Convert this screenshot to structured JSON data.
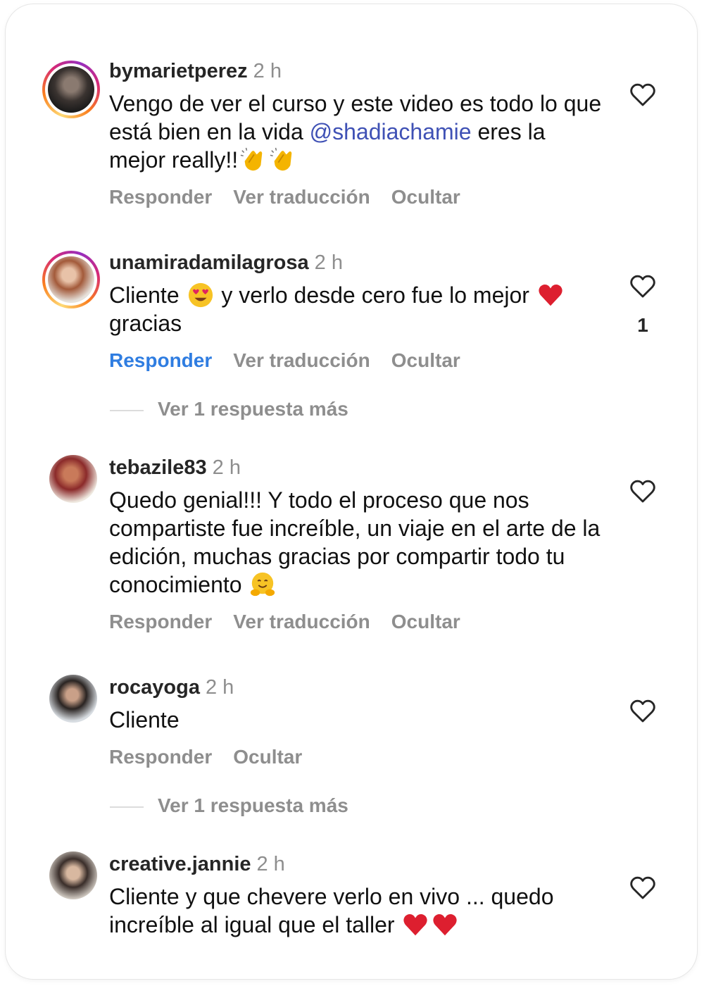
{
  "actions": {
    "reply": "Responder",
    "translate": "Ver traducción",
    "hide": "Ocultar"
  },
  "comments": [
    {
      "username": "bymarietperez",
      "time": "2 h",
      "text_before": "Vengo de ver el curso y este video es todo lo que está bien en la vida ",
      "mention": "@shadiachamie",
      "text_after": " eres la mejor really!!",
      "emojis": [
        "clapping-hands",
        "clapping-hands"
      ]
    },
    {
      "username": "unamiradamilagrosa",
      "time": "2 h",
      "text_a": "Cliente ",
      "text_b": " y verlo desde cero fue lo mejor ",
      "text_c": " gracias",
      "emojis": [
        "heart-eyes-face",
        "red-heart"
      ],
      "like_count": "1",
      "more_replies": "Ver 1 respuesta más"
    },
    {
      "username": "tebazile83",
      "time": "2 h",
      "text": "Quedo genial!!! Y todo el proceso que nos compartiste fue increíble, un viaje en el arte de la edición, muchas gracias por compartir todo tu conocimiento ",
      "emojis": [
        "hugging-face"
      ]
    },
    {
      "username": "rocayoga",
      "time": "2 h",
      "text": "Cliente",
      "more_replies": "Ver 1 respuesta más"
    },
    {
      "username": "creative.jannie",
      "time": "2 h",
      "text": "Cliente y que chevere verlo en vivo ... quedo increíble al igual que el taller ",
      "emojis": [
        "red-heart",
        "red-heart"
      ]
    }
  ],
  "icons": {
    "like": "heart-outline-icon"
  },
  "colors": {
    "mention": "#3f51b5",
    "active_reply": "#2f7de1",
    "muted": "#8e8e8e"
  }
}
